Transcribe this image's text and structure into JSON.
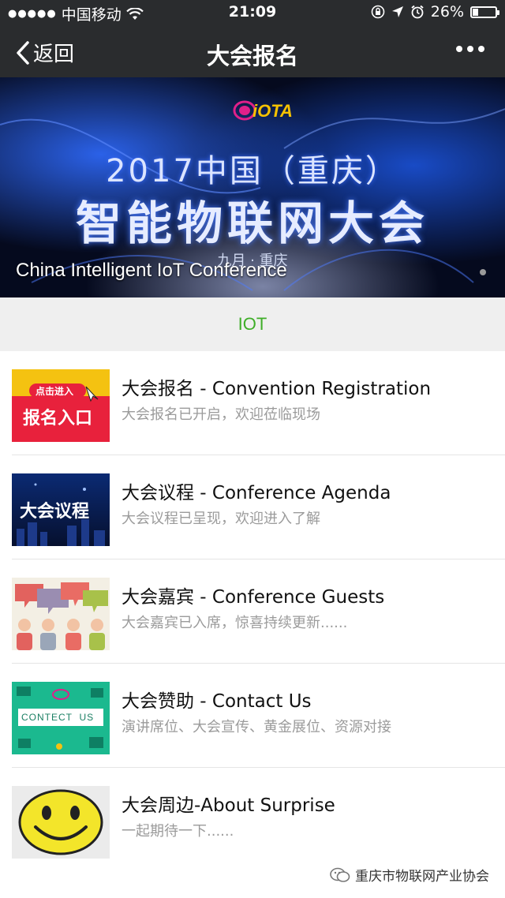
{
  "status": {
    "carrier": "中国移动",
    "time": "21:09",
    "battery": "26%",
    "battery_level": 0.26
  },
  "navbar": {
    "back_label": "返回",
    "title": "大会报名"
  },
  "banner": {
    "logo_text": "iOTA",
    "headline_line1": "2017中国（重庆）",
    "headline_line2": "智能物联网大会",
    "date_text": "九月 · 重庆",
    "caption": "China Intelligent IoT Conference"
  },
  "category": {
    "label": "IOT"
  },
  "items": [
    {
      "title": "大会报名 - Convention Registration",
      "subtitle": "大会报名已开启，欢迎莅临现场",
      "thumb_tag": "点击进入",
      "thumb_text": "报名入口"
    },
    {
      "title": "大会议程 - Conference Agenda",
      "subtitle": "大会议程已呈现，欢迎进入了解",
      "thumb_text": "大会议程"
    },
    {
      "title": "大会嘉宾 - Conference Guests",
      "subtitle": "大会嘉宾已入席，惊喜持续更新......"
    },
    {
      "title": "大会赞助 - Contact Us",
      "subtitle": "演讲席位、大会宣传、黄金展位、资源对接",
      "thumb_text": "CONTECT  US"
    },
    {
      "title": "大会周边-About Surprise",
      "subtitle": "一起期待一下......"
    }
  ],
  "footer": {
    "account_name": "重庆市物联网产业协会"
  },
  "colors": {
    "topbar": "#2a2c2e",
    "accent_green": "#3fae29",
    "category_bg": "#efefef"
  }
}
